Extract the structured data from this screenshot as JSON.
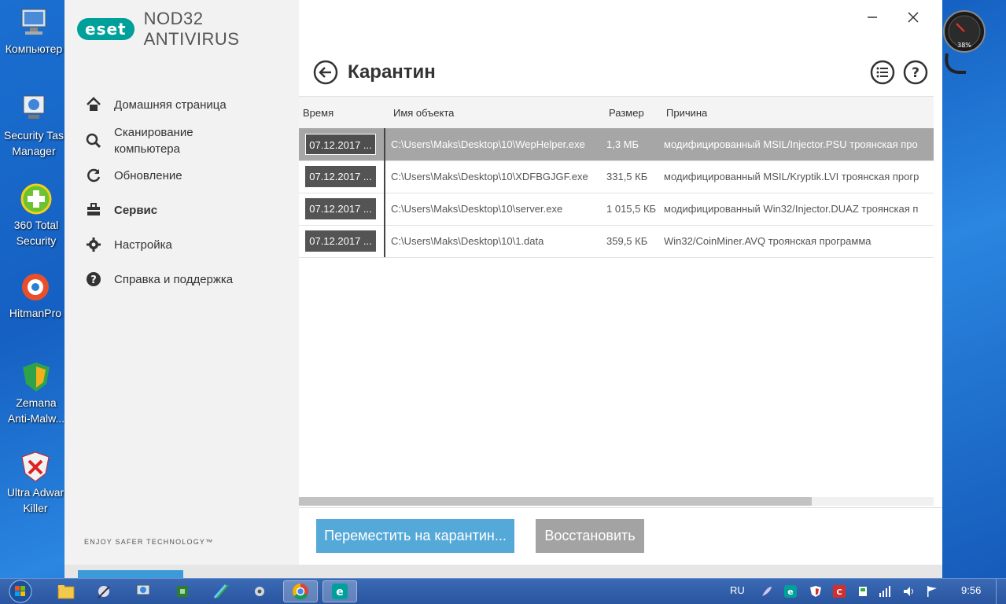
{
  "desktop": {
    "icons": [
      {
        "label": "Компьютер"
      },
      {
        "label": "Security Tas",
        "label2": "Manager"
      },
      {
        "label": "360 Total",
        "label2": "Security"
      },
      {
        "label": "HitmanPro"
      },
      {
        "label": "Zemana",
        "label2": "Anti-Malw..."
      },
      {
        "label": "Ultra Adwar",
        "label2": "Killer"
      }
    ],
    "gauge_text": "38%"
  },
  "app": {
    "brand": "eset",
    "product": "NOD32 ANTIVIRUS",
    "tagline": "ENJOY SAFER TECHNOLOGY™",
    "nav": [
      {
        "label": "Домашняя страница",
        "icon": "home-icon"
      },
      {
        "label": "Сканирование",
        "label2": "компьютера",
        "icon": "magnifier-icon"
      },
      {
        "label": "Обновление",
        "icon": "refresh-icon"
      },
      {
        "label": "Сервис",
        "icon": "toolbox-icon",
        "active": true
      },
      {
        "label": "Настройка",
        "icon": "gear-icon"
      },
      {
        "label": "Справка и поддержка",
        "icon": "help-icon"
      }
    ]
  },
  "page": {
    "title": "Карантин"
  },
  "table": {
    "headers": {
      "time": "Время",
      "name": "Имя объекта",
      "size": "Размер",
      "reason": "Причина"
    },
    "rows": [
      {
        "time": "07.12.2017 ...",
        "name": "C:\\Users\\Maks\\Desktop\\10\\WepHelper.exe",
        "size": "1,3 МБ",
        "reason": "модифицированный MSIL/Injector.PSU троянская про"
      },
      {
        "time": "07.12.2017 ...",
        "name": "C:\\Users\\Maks\\Desktop\\10\\XDFBGJGF.exe",
        "size": "331,5 КБ",
        "reason": "модифицированный MSIL/Kryptik.LVI троянская прогр"
      },
      {
        "time": "07.12.2017 ...",
        "name": "C:\\Users\\Maks\\Desktop\\10\\server.exe",
        "size": "1 015,5 КБ",
        "reason": "модифицированный Win32/Injector.DUAZ троянская п"
      },
      {
        "time": "07.12.2017 ...",
        "name": "C:\\Users\\Maks\\Desktop\\10\\1.data",
        "size": "359,5 КБ",
        "reason": "Win32/CoinMiner.AVQ троянская программа"
      }
    ]
  },
  "buttons": {
    "move": "Переместить на карантин...",
    "restore": "Восстановить"
  },
  "taskbar": {
    "lang": "RU",
    "time": "9:56"
  }
}
